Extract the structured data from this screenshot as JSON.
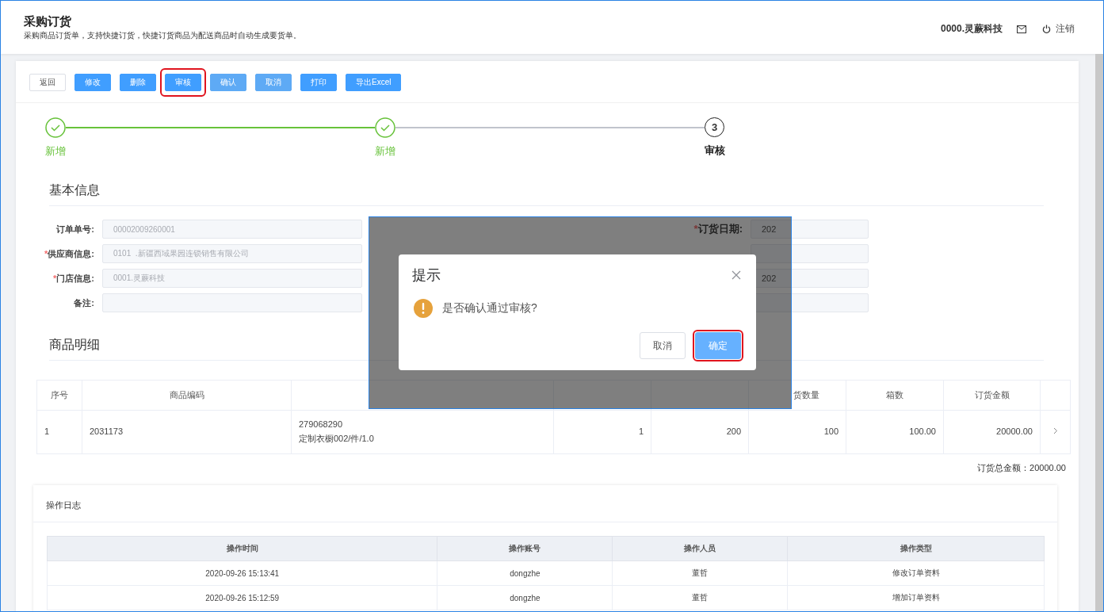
{
  "header": {
    "title": "采购订货",
    "subtitle": "采购商品订货单，支持快捷订货，快捷订货商品为配送商品时自动生成要货单。",
    "user": "0000.灵蕨科技",
    "logout": "注销"
  },
  "toolbar": [
    {
      "label": "返回",
      "kind": "default",
      "disabled": false,
      "highlighted": false
    },
    {
      "label": "修改",
      "kind": "primary",
      "disabled": false,
      "highlighted": false
    },
    {
      "label": "删除",
      "kind": "primary",
      "disabled": false,
      "highlighted": false
    },
    {
      "label": "审核",
      "kind": "primary",
      "disabled": false,
      "highlighted": true
    },
    {
      "label": "确认",
      "kind": "primary",
      "disabled": true,
      "highlighted": false
    },
    {
      "label": "取消",
      "kind": "primary",
      "disabled": true,
      "highlighted": false
    },
    {
      "label": "打印",
      "kind": "primary",
      "disabled": false,
      "highlighted": false
    },
    {
      "label": "导出Excel",
      "kind": "primary",
      "disabled": false,
      "highlighted": false
    }
  ],
  "steps": [
    {
      "title": "新增",
      "completed": true
    },
    {
      "title": "新增",
      "completed": true
    },
    {
      "title": "审核",
      "completed": false,
      "number": "3"
    }
  ],
  "basic_info": {
    "title": "基本信息",
    "left_fields": [
      {
        "label": "订单单号:",
        "value": "00002009260001",
        "disabled": true
      },
      {
        "marker": "*",
        "label": "供应商信息:",
        "value": "0101  .新疆西域果园连锁销售有限公司",
        "disabled": true
      },
      {
        "marker": "*",
        "label": "门店信息:",
        "value": "0001.灵蕨科技",
        "disabled": true
      },
      {
        "label": "备注:",
        "disabled": true
      }
    ],
    "right_fields": [
      {
        "marker": "*",
        "label": "订货日期:",
        "value": "202",
        "disabled": true
      },
      {
        "disabled": true
      },
      {
        "value": "202",
        "disabled": true
      },
      {
        "disabled": true
      }
    ]
  },
  "details": {
    "title": "商品明细",
    "columns": [
      "序号",
      "商品编码",
      null,
      null,
      null,
      "货数量",
      "箱数",
      "订货金额"
    ],
    "rows": [
      {
        "cells": [
          "1",
          "2031173",
          "279068290\n定制衣橱002/件/1.0",
          "1",
          "200",
          "100",
          "100.00",
          "20000.00"
        ]
      }
    ],
    "total": "订货总金额：20000.00"
  },
  "log": {
    "title": "操作日志",
    "columns": [
      "操作时间",
      "操作账号",
      "操作人员",
      "操作类型"
    ],
    "rows": [
      [
        "2020-09-26 15:13:41",
        "dongzhe",
        "董哲",
        "修改订单资料"
      ],
      [
        "2020-09-26 15:12:59",
        "dongzhe",
        "董哲",
        "增加订单资料"
      ]
    ]
  },
  "dialog": {
    "title": "提示",
    "message": "是否确认通过审核?",
    "buttons": [
      {
        "label": "取消",
        "kind": "default",
        "highlighted": false
      },
      {
        "label": "确定",
        "kind": "primary",
        "highlighted": true
      }
    ]
  }
}
